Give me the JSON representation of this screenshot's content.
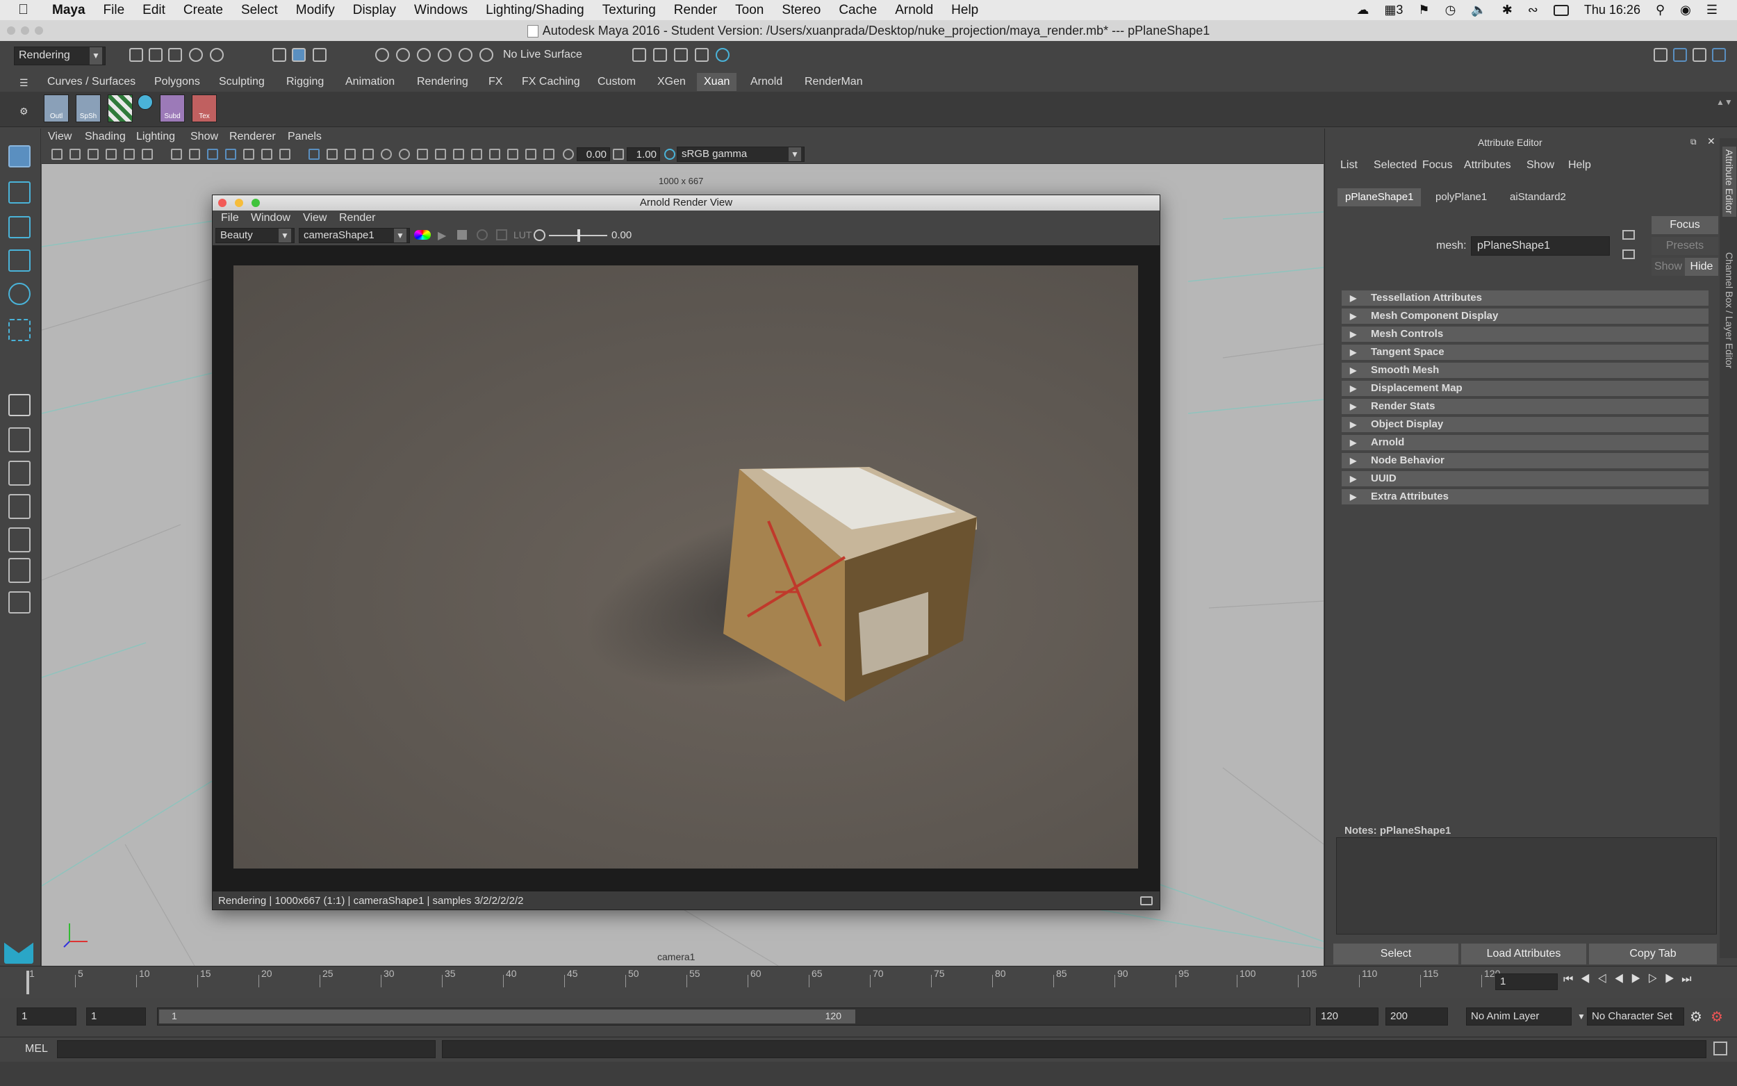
{
  "mac_menubar": {
    "apple": "",
    "app_name": "Maya",
    "items": [
      "File",
      "Edit",
      "Create",
      "Select",
      "Modify",
      "Display",
      "Windows",
      "Lighting/Shading",
      "Texturing",
      "Render",
      "Toon",
      "Stereo",
      "Cache",
      "Arnold",
      "Help"
    ],
    "clock": "Thu 16:26",
    "notif_count": "3"
  },
  "window_title": "Autodesk Maya 2016 - Student Version: /Users/xuanprada/Desktop/nuke_projection/maya_render.mb*   ---   pPlaneShape1",
  "statusline": {
    "menuset": "Rendering",
    "live_surface": "No Live Surface"
  },
  "shelf": {
    "tabs": [
      "Curves / Surfaces",
      "Polygons",
      "Sculpting",
      "Rigging",
      "Animation",
      "Rendering",
      "FX",
      "FX Caching",
      "Custom",
      "XGen",
      "Xuan",
      "Arnold",
      "RenderMan"
    ],
    "active_tab": "Xuan",
    "buttons": [
      "Outl",
      "SpSh",
      "",
      "",
      "Subd",
      "Tex"
    ]
  },
  "viewport": {
    "menu": [
      "View",
      "Shading",
      "Lighting",
      "Show",
      "Renderer",
      "Panels"
    ],
    "exposure": "0.00",
    "gamma": "1.00",
    "colorspace": "sRGB gamma",
    "resolution_label": "1000 x 667",
    "camera_label": "camera1"
  },
  "render_view": {
    "title": "Arnold Render View",
    "menu": [
      "File",
      "Window",
      "View",
      "Render"
    ],
    "aov": "Beauty",
    "camera": "cameraShape1",
    "lut_label": "LUT",
    "exposure": "0.00",
    "status": "Rendering | 1000x667 (1:1) | cameraShape1  | samples 3/2/2/2/2/2"
  },
  "attribute_editor": {
    "title": "Attribute Editor",
    "menu": [
      "List",
      "Selected",
      "Focus",
      "Attributes",
      "Show",
      "Help"
    ],
    "tabs": [
      "pPlaneShape1",
      "polyPlane1",
      "aiStandard2"
    ],
    "mesh_label": "mesh:",
    "mesh_value": "pPlaneShape1",
    "focus_btn": "Focus",
    "presets_btn": "Presets",
    "show_btn": "Show",
    "hide_btn": "Hide",
    "sections": [
      "Tessellation Attributes",
      "Mesh Component Display",
      "Mesh Controls",
      "Tangent Space",
      "Smooth Mesh",
      "Displacement Map",
      "Render Stats",
      "Object Display",
      "Arnold",
      "Node Behavior",
      "UUID",
      "Extra Attributes"
    ],
    "notes_label": "Notes:  pPlaneShape1",
    "bottom_buttons": [
      "Select",
      "Load Attributes",
      "Copy Tab"
    ],
    "side_tabs": [
      "Attribute Editor",
      "Channel Box / Layer Editor"
    ]
  },
  "timeline": {
    "ticks": [
      "1",
      "5",
      "10",
      "15",
      "20",
      "25",
      "30",
      "35",
      "40",
      "45",
      "50",
      "55",
      "60",
      "65",
      "70",
      "75",
      "80",
      "85",
      "90",
      "95",
      "100",
      "105",
      "110",
      "115",
      "120"
    ],
    "current_frame": "1"
  },
  "range": {
    "start": "1",
    "anim_start": "1",
    "slider_start": "1",
    "slider_end": "120",
    "end": "120",
    "anim_end": "200",
    "anim_layer": "No Anim Layer",
    "character_set": "No Character Set"
  },
  "cmdline": {
    "label": "MEL"
  }
}
